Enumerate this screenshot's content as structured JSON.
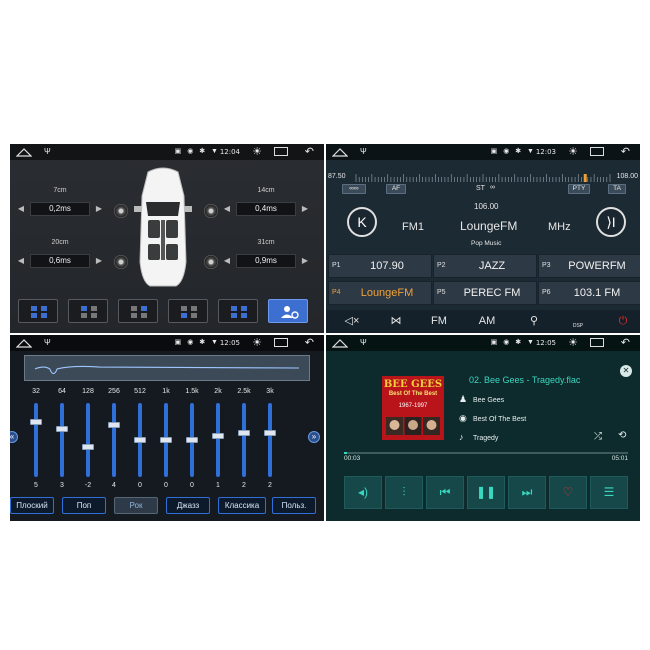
{
  "colors": {
    "accent_blue": "#2f6fd8",
    "accent_teal": "#3ad7c0",
    "accent_orange": "#f0a038",
    "power_red": "#e03030"
  },
  "speaker_panel": {
    "status": {
      "time": "12:04"
    },
    "front_left": {
      "distance": "7cm",
      "delay": "0,2ms"
    },
    "front_right": {
      "distance": "14cm",
      "delay": "0,4ms"
    },
    "rear_left": {
      "distance": "20cm",
      "delay": "0,6ms"
    },
    "rear_right": {
      "distance": "31cm",
      "delay": "0,9ms"
    },
    "seat_presets": [
      "seat-all-icon",
      "seat-front-left-icon",
      "seat-front-right-icon",
      "seat-rear-left-icon",
      "seat-rear-right-icon",
      "user-settings-icon"
    ],
    "active_seat_preset": 5
  },
  "radio_panel": {
    "status": {
      "time": "12:03"
    },
    "chips": {
      "af": "AF",
      "pty": "PTY",
      "ta": "TA",
      "st": "ST"
    },
    "scale": {
      "min": "87.50",
      "max": "108.00",
      "current": 106.0
    },
    "frequency": "106.00",
    "band": "FM1",
    "station": "LoungeFM",
    "unit": "MHz",
    "genre": "Pop Music",
    "presets": [
      {
        "num": "P1",
        "label": "107.90"
      },
      {
        "num": "P2",
        "label": "JAZZ"
      },
      {
        "num": "P3",
        "label": "POWERFM"
      },
      {
        "num": "P4",
        "label": "LoungeFM",
        "selected": true
      },
      {
        "num": "P5",
        "label": "PEREC FM"
      },
      {
        "num": "P6",
        "label": "103.1 FM"
      }
    ],
    "bottom": {
      "fm": "FM",
      "am": "AM",
      "dsp": "DSP"
    }
  },
  "eq_panel": {
    "status": {
      "time": "12:05"
    },
    "bands": [
      {
        "freq": "32",
        "value": "5"
      },
      {
        "freq": "64",
        "value": "3"
      },
      {
        "freq": "128",
        "value": "-2"
      },
      {
        "freq": "256",
        "value": "4"
      },
      {
        "freq": "512",
        "value": "0"
      },
      {
        "freq": "1k",
        "value": "0"
      },
      {
        "freq": "1.5k",
        "value": "0"
      },
      {
        "freq": "2k",
        "value": "1"
      },
      {
        "freq": "2.5k",
        "value": "2"
      },
      {
        "freq": "3k",
        "value": "2"
      }
    ],
    "presets": [
      "Плоский",
      "Поп",
      "Рок",
      "Джазз",
      "Классика",
      "Польз."
    ],
    "selected_preset": "Рок"
  },
  "music_panel": {
    "status": {
      "time": "12:05"
    },
    "album_art": {
      "line1": "BEE GEES",
      "line2": "Best Of The Best",
      "line3": "1967-1997"
    },
    "track_title": "02. Bee Gees - Tragedy.flac",
    "artist": "Bee Gees",
    "album": "Best Of The Best",
    "song": "Tragedy",
    "elapsed": "00:03",
    "duration": "05:01",
    "progress": 0.01
  }
}
